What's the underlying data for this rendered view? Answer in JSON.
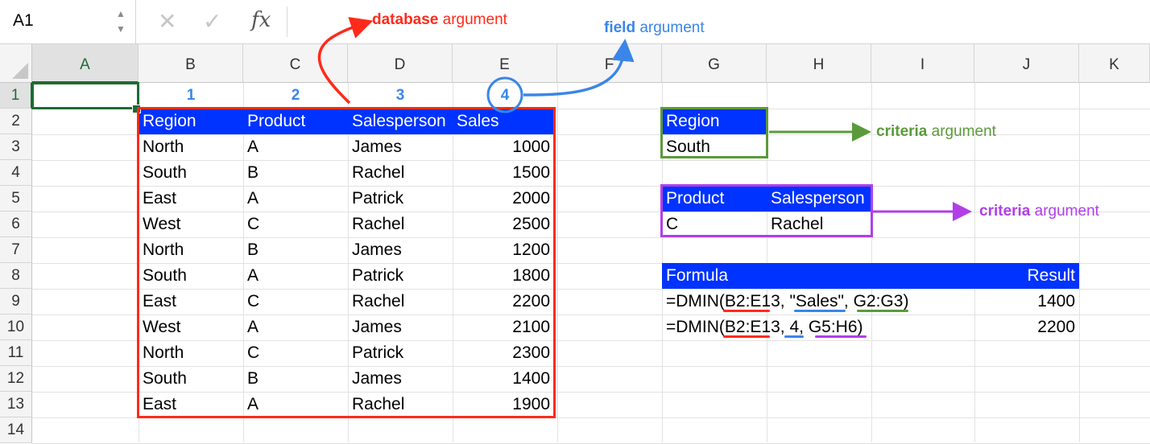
{
  "formula_bar": {
    "name_box": "A1",
    "spin_up": "▲",
    "spin_down": "▼",
    "cancel_glyph": "✕",
    "enter_glyph": "✓",
    "fx_label": "fx"
  },
  "columns": [
    "A",
    "B",
    "C",
    "D",
    "E",
    "F",
    "G",
    "H",
    "I",
    "J",
    "K"
  ],
  "rows": [
    "1",
    "2",
    "3",
    "4",
    "5",
    "6",
    "7",
    "8",
    "9",
    "10",
    "11",
    "12",
    "13",
    "14"
  ],
  "field_numbers": [
    "1",
    "2",
    "3",
    "4"
  ],
  "database": {
    "headers": [
      "Region",
      "Product",
      "Salesperson",
      "Sales"
    ],
    "rows": [
      [
        "North",
        "A",
        "James",
        "1000"
      ],
      [
        "South",
        "B",
        "Rachel",
        "1500"
      ],
      [
        "East",
        "A",
        "Patrick",
        "2000"
      ],
      [
        "West",
        "C",
        "Rachel",
        "2500"
      ],
      [
        "North",
        "B",
        "James",
        "1200"
      ],
      [
        "South",
        "A",
        "Patrick",
        "1800"
      ],
      [
        "East",
        "C",
        "Rachel",
        "2200"
      ],
      [
        "West",
        "A",
        "James",
        "2100"
      ],
      [
        "North",
        "C",
        "Patrick",
        "2300"
      ],
      [
        "South",
        "B",
        "James",
        "1400"
      ],
      [
        "East",
        "A",
        "Rachel",
        "1900"
      ]
    ]
  },
  "criteria1": {
    "header": "Region",
    "value": "South"
  },
  "criteria2": {
    "headers": [
      "Product",
      "Salesperson"
    ],
    "values": [
      "C",
      "Rachel"
    ]
  },
  "formulas": {
    "header_formula": "Formula",
    "header_result": "Result",
    "rows": [
      {
        "formula": "=DMIN(B2:E13, \"Sales\", G2:G3)",
        "result": "1400"
      },
      {
        "formula": "=DMIN(B2:E13, 4, G5:H6)",
        "result": "2200"
      }
    ]
  },
  "annotations": {
    "database": {
      "bold": "database",
      "rest": " argument",
      "color": "#ff2a1a"
    },
    "field": {
      "bold": "field",
      "rest": " argument",
      "color": "#3a86e8"
    },
    "criteria_green": {
      "bold": "criteria",
      "rest": " argument",
      "color": "#5b9a3a"
    },
    "criteria_purple": {
      "bold": "criteria",
      "rest": " argument",
      "color": "#b23ee8"
    }
  },
  "colors": {
    "header_blue": "#0033ff",
    "database_red": "#ff2a1a",
    "field_blue": "#3a86e8",
    "criteria_green": "#5b9a3a",
    "criteria_purple": "#b23ee8",
    "selection_green": "#1d6b34"
  },
  "icons": [
    "cancel-icon",
    "enter-icon",
    "fx-icon",
    "spin-arrows-icon",
    "select-all-icon"
  ]
}
